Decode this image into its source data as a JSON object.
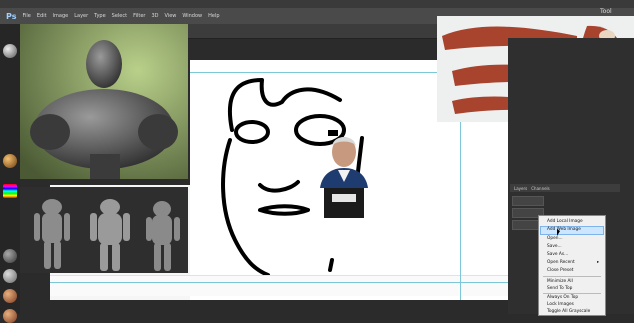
{
  "photoshop": {
    "logo": "Ps",
    "menu": [
      "File",
      "Edit",
      "Image",
      "Layer",
      "Type",
      "Select",
      "Filter",
      "3D",
      "View",
      "Window",
      "Help"
    ]
  },
  "zbrush": {
    "tool_label": "Tool"
  },
  "layers_panel": {
    "tabs": [
      "Layers",
      "Channels"
    ]
  },
  "context_menu": {
    "items": [
      "Add Local Image",
      "Add Web Image",
      "Open...",
      "Save...",
      "Save As...",
      "Open Recent",
      "Close Preset",
      "Minimize All",
      "Send To Top",
      "Always On Top",
      "Lock Images",
      "Toggle All Grayscale"
    ],
    "highlighted": "Add Web Image"
  },
  "colors": {
    "ps_accent": "#9fd0ff",
    "guide": "#7cc8d8",
    "highlight": "#cde6ff"
  }
}
